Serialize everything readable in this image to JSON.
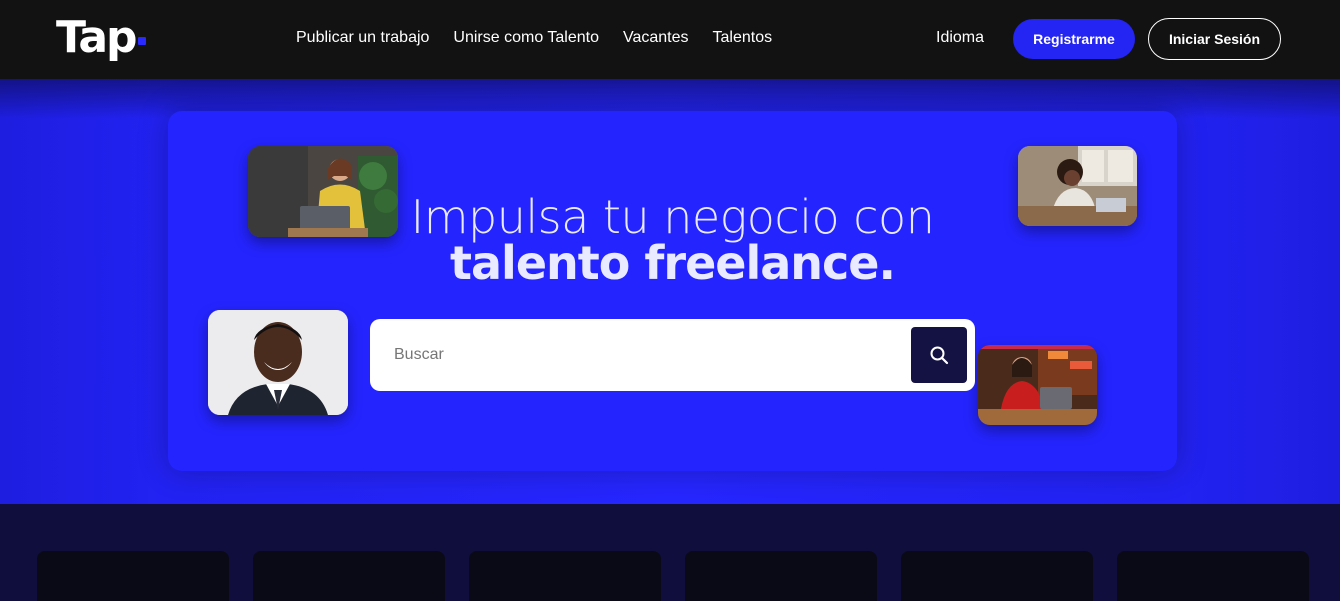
{
  "header": {
    "logo": "Tap",
    "nav": [
      "Publicar un trabajo",
      "Unirse como Talento",
      "Vacantes",
      "Talentos"
    ],
    "language": "Idioma",
    "register": "Registrarme",
    "login": "Iniciar Sesión"
  },
  "hero": {
    "title_light": "Impulsa tu negocio con",
    "title_bold": "talento freelance."
  },
  "search": {
    "placeholder": "Buscar",
    "icon": "search-icon"
  },
  "colors": {
    "brand_blue": "#2424ff",
    "header_bg": "#121212",
    "search_button": "#141242"
  }
}
